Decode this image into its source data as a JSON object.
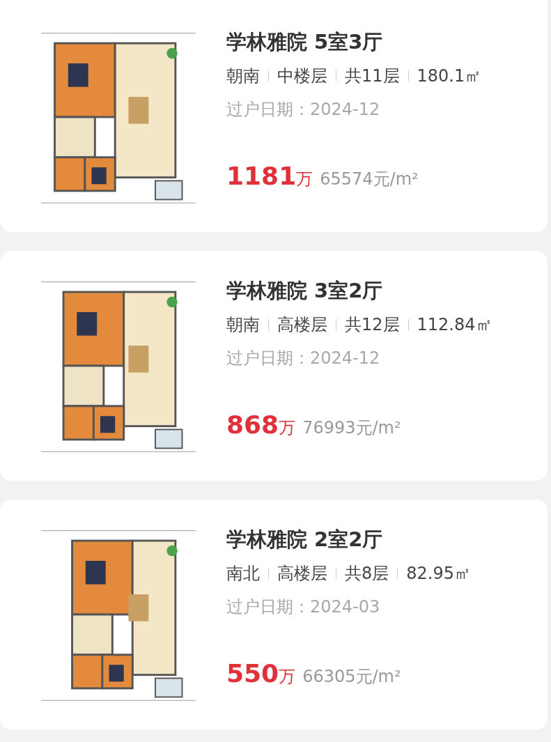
{
  "listings": [
    {
      "title": "学林雅院 5室3厅",
      "attributes": [
        "朝南",
        "中楼层",
        "共11层",
        "180.1㎡"
      ],
      "transfer_date": "过户日期：2024-12",
      "price": "1181",
      "price_unit": "万",
      "unit_price": "65574元/m²"
    },
    {
      "title": "学林雅院 3室2厅",
      "attributes": [
        "朝南",
        "高楼层",
        "共12层",
        "112.84㎡"
      ],
      "transfer_date": "过户日期：2024-12",
      "price": "868",
      "price_unit": "万",
      "unit_price": "76993元/m²"
    },
    {
      "title": "学林雅院 2室2厅",
      "attributes": [
        "南北",
        "高楼层",
        "共8层",
        "82.95㎡"
      ],
      "transfer_date": "过户日期：2024-03",
      "price": "550",
      "price_unit": "万",
      "unit_price": "66305元/m²"
    }
  ]
}
